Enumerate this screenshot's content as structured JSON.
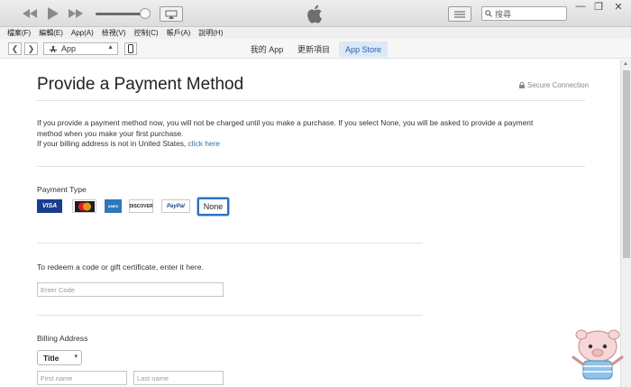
{
  "player": {
    "search_placeholder": "搜尋"
  },
  "menu": [
    "檔案(F)",
    "編輯(E)",
    "App(A)",
    "檢視(V)",
    "控制(C)",
    "帳戶(A)",
    "說明(H)"
  ],
  "navbar": {
    "app_selector": "App",
    "tabs": [
      "我的 App",
      "更新項目",
      "App Store"
    ],
    "active_tab": "App Store"
  },
  "page": {
    "title": "Provide a Payment Method",
    "secure": "Secure Connection",
    "intro_line1": "If you provide a payment method now, you will not be charged until you make a purchase. If you select None, you will be asked to provide a payment",
    "intro_line2": "method when you make your first purchase.",
    "billing_note": "If your billing address is not in United States,",
    "billing_link": "click here",
    "payment_type_label": "Payment Type",
    "cards": [
      "VISA",
      "MasterCard",
      "AMEX",
      "DISCOVER",
      "PayPal"
    ],
    "none_label": "None",
    "redeem_label": "To redeem a code or gift certificate, enter it here.",
    "code_placeholder": "Enter Code",
    "billing_address_label": "Billing Address",
    "title_select": "Title",
    "first_name_placeholder": "First name",
    "last_name_placeholder": "Last name"
  },
  "colors": {
    "accent": "#2c6fbf",
    "active_tab_bg": "#dbe8f6",
    "visa": "#1a3d8f",
    "amex": "#2e77bb"
  }
}
